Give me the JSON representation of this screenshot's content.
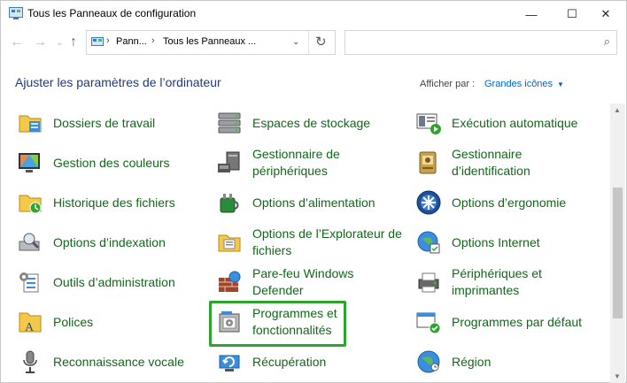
{
  "window": {
    "title": "Tous les Panneaux de configuration",
    "minimize": "—",
    "maximize": "☐",
    "close": "✕"
  },
  "address": {
    "crumbs": [
      "Pann...",
      "Tous les Panneaux ..."
    ]
  },
  "search": {
    "placeholder": ""
  },
  "header": {
    "title": "Ajuster les paramètres de l’ordinateur",
    "view_by_label": "Afficher par :",
    "view_by_value": "Grandes icônes"
  },
  "items": [
    {
      "label": "Dossiers de travail",
      "icon": "work-folders-icon"
    },
    {
      "label": "Espaces de stockage",
      "icon": "storage-spaces-icon"
    },
    {
      "label": "Exécution automatique",
      "icon": "autoplay-icon"
    },
    {
      "label": "Gestion des couleurs",
      "icon": "color-management-icon"
    },
    {
      "label": "Gestionnaire de périphériques",
      "icon": "device-manager-icon"
    },
    {
      "label": "Gestionnaire d’identification",
      "icon": "credential-manager-icon"
    },
    {
      "label": "Historique des fichiers",
      "icon": "file-history-icon"
    },
    {
      "label": "Options d’alimentation",
      "icon": "power-options-icon"
    },
    {
      "label": "Options d’ergonomie",
      "icon": "ease-of-access-icon"
    },
    {
      "label": "Options d’indexation",
      "icon": "indexing-options-icon"
    },
    {
      "label": "Options de l’Explorateur de fichiers",
      "icon": "file-explorer-options-icon"
    },
    {
      "label": "Options Internet",
      "icon": "internet-options-icon"
    },
    {
      "label": "Outils d’administration",
      "icon": "admin-tools-icon"
    },
    {
      "label": "Pare-feu Windows Defender",
      "icon": "firewall-icon"
    },
    {
      "label": "Périphériques et imprimantes",
      "icon": "devices-printers-icon"
    },
    {
      "label": "Polices",
      "icon": "fonts-icon"
    },
    {
      "label": "Programmes et fonctionnalités",
      "icon": "programs-features-icon"
    },
    {
      "label": "Programmes par défaut",
      "icon": "default-programs-icon"
    },
    {
      "label": "Reconnaissance vocale",
      "icon": "speech-recognition-icon"
    },
    {
      "label": "Récupération",
      "icon": "recovery-icon"
    },
    {
      "label": "Région",
      "icon": "region-icon"
    }
  ],
  "highlighted_item": "Programmes et fonctionnalités",
  "colors": {
    "link_green": "#13661a",
    "heading_blue": "#1e3a87",
    "highlight": "#2ca52c"
  }
}
